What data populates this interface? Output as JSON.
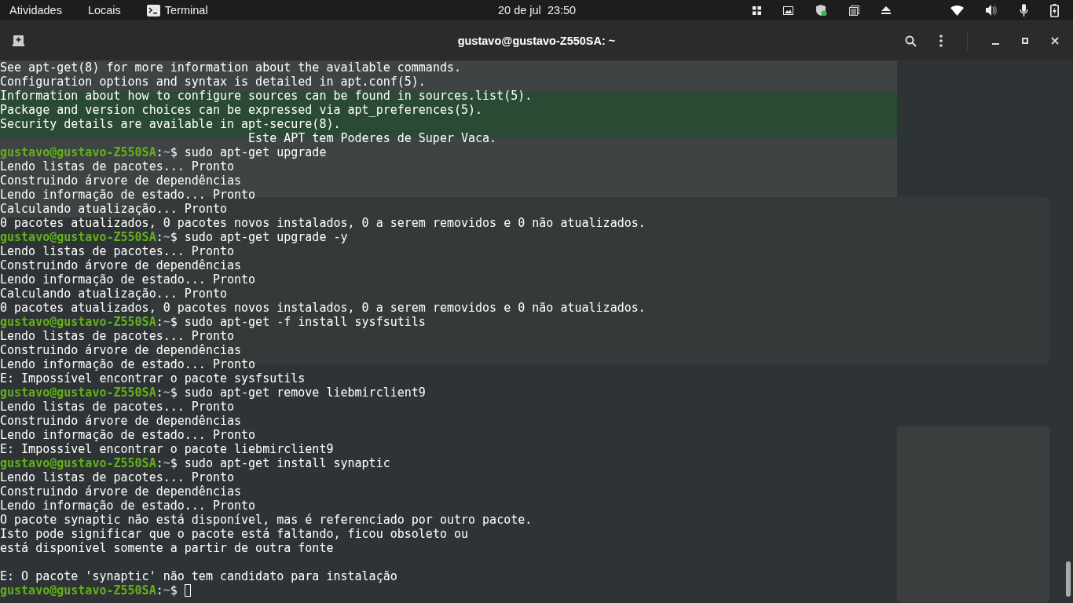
{
  "top_bar": {
    "activities": "Atividades",
    "places": "Locais",
    "app": "Terminal",
    "clock": "20 de jul  23:50"
  },
  "window": {
    "title": "gustavo@gustavo-Z550SA: ~"
  },
  "terminal": {
    "lines": [
      {
        "kind": "output",
        "text": "See apt-get(8) for more information about the available commands."
      },
      {
        "kind": "output",
        "text": "Configuration options and syntax is detailed in apt.conf(5)."
      },
      {
        "kind": "output",
        "text": "Information about how to configure sources can be found in sources.list(5)."
      },
      {
        "kind": "output",
        "text": "Package and version choices can be expressed via apt_preferences(5)."
      },
      {
        "kind": "output",
        "text": "Security details are available in apt-secure(8)."
      },
      {
        "kind": "banner",
        "text": "Este APT tem Poderes de Super Vaca."
      },
      {
        "kind": "prompt",
        "user": "gustavo@gustavo-Z550SA",
        "sep": ":",
        "path": "~",
        "symbol": "$",
        "command": "sudo apt-get upgrade"
      },
      {
        "kind": "output",
        "text": "Lendo listas de pacotes... Pronto"
      },
      {
        "kind": "output",
        "text": "Construindo árvore de dependências"
      },
      {
        "kind": "output",
        "text": "Lendo informação de estado... Pronto"
      },
      {
        "kind": "output",
        "text": "Calculando atualização... Pronto"
      },
      {
        "kind": "output",
        "text": "0 pacotes atualizados, 0 pacotes novos instalados, 0 a serem removidos e 0 não atualizados."
      },
      {
        "kind": "prompt",
        "user": "gustavo@gustavo-Z550SA",
        "sep": ":",
        "path": "~",
        "symbol": "$",
        "command": "sudo apt-get upgrade -y"
      },
      {
        "kind": "output",
        "text": "Lendo listas de pacotes... Pronto"
      },
      {
        "kind": "output",
        "text": "Construindo árvore de dependências"
      },
      {
        "kind": "output",
        "text": "Lendo informação de estado... Pronto"
      },
      {
        "kind": "output",
        "text": "Calculando atualização... Pronto"
      },
      {
        "kind": "output",
        "text": "0 pacotes atualizados, 0 pacotes novos instalados, 0 a serem removidos e 0 não atualizados."
      },
      {
        "kind": "prompt",
        "user": "gustavo@gustavo-Z550SA",
        "sep": ":",
        "path": "~",
        "symbol": "$",
        "command": "sudo apt-get -f install sysfsutils"
      },
      {
        "kind": "output",
        "text": "Lendo listas de pacotes... Pronto"
      },
      {
        "kind": "output",
        "text": "Construindo árvore de dependências"
      },
      {
        "kind": "output",
        "text": "Lendo informação de estado... Pronto"
      },
      {
        "kind": "output",
        "text": "E: Impossível encontrar o pacote sysfsutils"
      },
      {
        "kind": "prompt",
        "user": "gustavo@gustavo-Z550SA",
        "sep": ":",
        "path": "~",
        "symbol": "$",
        "command": "sudo apt-get remove liebmirclient9"
      },
      {
        "kind": "output",
        "text": "Lendo listas de pacotes... Pronto"
      },
      {
        "kind": "output",
        "text": "Construindo árvore de dependências"
      },
      {
        "kind": "output",
        "text": "Lendo informação de estado... Pronto"
      },
      {
        "kind": "output",
        "text": "E: Impossível encontrar o pacote liebmirclient9"
      },
      {
        "kind": "prompt",
        "user": "gustavo@gustavo-Z550SA",
        "sep": ":",
        "path": "~",
        "symbol": "$",
        "command": "sudo apt-get install synaptic"
      },
      {
        "kind": "output",
        "text": "Lendo listas de pacotes... Pronto"
      },
      {
        "kind": "output",
        "text": "Construindo árvore de dependências"
      },
      {
        "kind": "output",
        "text": "Lendo informação de estado... Pronto"
      },
      {
        "kind": "output",
        "text": "O pacote synaptic não está disponível, mas é referenciado por outro pacote."
      },
      {
        "kind": "output",
        "text": "Isto pode significar que o pacote está faltando, ficou obsoleto ou"
      },
      {
        "kind": "output",
        "text": "está disponível somente a partir de outra fonte"
      },
      {
        "kind": "blank"
      },
      {
        "kind": "output",
        "text": "E: O pacote 'synaptic' não tem candidato para instalação"
      },
      {
        "kind": "prompt",
        "user": "gustavo@gustavo-Z550SA",
        "sep": ":",
        "path": "~",
        "symbol": "$",
        "cursor": true
      }
    ]
  }
}
